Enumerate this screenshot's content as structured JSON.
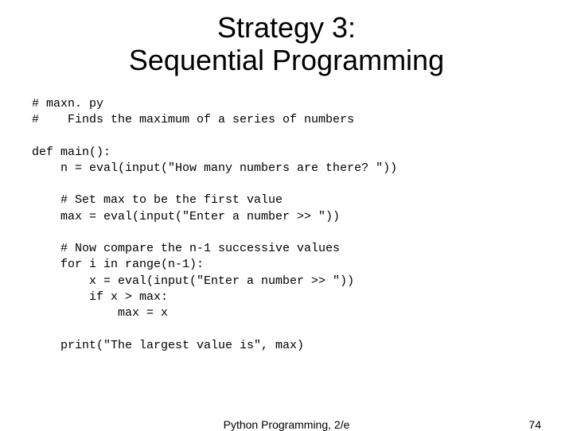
{
  "title_line1": "Strategy 3:",
  "title_line2": "Sequential Programming",
  "code": "# maxn. py\n#    Finds the maximum of a series of numbers\n\ndef main():\n    n = eval(input(\"How many numbers are there? \"))\n\n    # Set max to be the first value\n    max = eval(input(\"Enter a number >> \"))\n\n    # Now compare the n-1 successive values\n    for i in range(n-1):\n        x = eval(input(\"Enter a number >> \"))\n        if x > max:\n            max = x\n\n    print(\"The largest value is\", max)",
  "footer_center": "Python Programming, 2/e",
  "footer_right": "74"
}
